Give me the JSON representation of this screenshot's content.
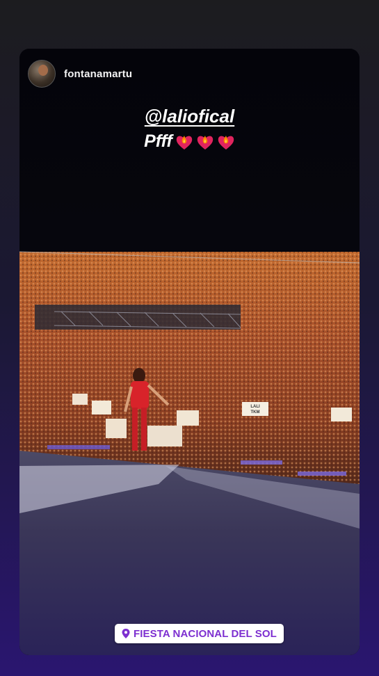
{
  "story": {
    "username": "fontanamartu",
    "caption": {
      "mention": "@laliofical",
      "text": "Pfff",
      "emoji": [
        "heart-on-fire-icon",
        "heart-on-fire-icon",
        "heart-on-fire-icon"
      ]
    },
    "crowd_signs": [
      "LALI",
      "TKM"
    ],
    "location_sticker": "FIESTA NACIONAL DEL SOL"
  },
  "colors": {
    "background_top": "#1c1c1f",
    "background_bottom": "#2a1670",
    "location_text": "#7d2fd0",
    "heart": "#e0245e",
    "flame": "#ff8a00"
  }
}
